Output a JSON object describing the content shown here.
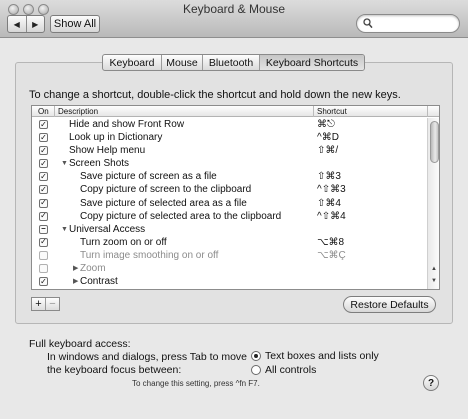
{
  "window": {
    "title": "Keyboard & Mouse",
    "show_all_label": "Show All",
    "back_icon": "◀",
    "forward_icon": "▶",
    "search_value": "",
    "search_placeholder": ""
  },
  "tabs": [
    {
      "label": "Keyboard",
      "active": false
    },
    {
      "label": "Mouse",
      "active": false
    },
    {
      "label": "Bluetooth",
      "active": false
    },
    {
      "label": "Keyboard Shortcuts",
      "active": true
    }
  ],
  "instructions": "To change a shortcut, double-click the shortcut and hold down the new keys.",
  "table": {
    "col_on": "On",
    "col_description": "Description",
    "col_shortcut": "Shortcut",
    "rows": [
      {
        "state": "checked",
        "indent": 1,
        "expander": "",
        "description": "Hide and show Front Row",
        "shortcut": "⌘⎋",
        "dim": false
      },
      {
        "state": "checked",
        "indent": 1,
        "expander": "",
        "description": "Look up in Dictionary",
        "shortcut": "^⌘D",
        "dim": false
      },
      {
        "state": "checked",
        "indent": 1,
        "expander": "",
        "description": "Show Help menu",
        "shortcut": "⇧⌘/",
        "dim": false
      },
      {
        "state": "checked",
        "indent": 0,
        "expander": "▼",
        "description": "Screen Shots",
        "shortcut": "",
        "dim": false
      },
      {
        "state": "checked",
        "indent": 2,
        "expander": "",
        "description": "Save picture of screen as a file",
        "shortcut": "⇧⌘3",
        "dim": false
      },
      {
        "state": "checked",
        "indent": 2,
        "expander": "",
        "description": "Copy picture of screen to the clipboard",
        "shortcut": "^⇧⌘3",
        "dim": false
      },
      {
        "state": "checked",
        "indent": 2,
        "expander": "",
        "description": "Save picture of selected area as a file",
        "shortcut": "⇧⌘4",
        "dim": false
      },
      {
        "state": "checked",
        "indent": 2,
        "expander": "",
        "description": "Copy picture of selected area to the clipboard",
        "shortcut": "^⇧⌘4",
        "dim": false
      },
      {
        "state": "mixed",
        "indent": 0,
        "expander": "▼",
        "description": "Universal Access",
        "shortcut": "",
        "dim": false
      },
      {
        "state": "checked",
        "indent": 2,
        "expander": "",
        "description": "Turn zoom on or off",
        "shortcut": "⌥⌘8",
        "dim": false
      },
      {
        "state": "unchecked",
        "indent": 2,
        "expander": "",
        "description": "Turn image smoothing on or off",
        "shortcut": "⌥⌘Ç",
        "dim": true
      },
      {
        "state": "unchecked",
        "indent": 1,
        "expander": "▶",
        "description": "Zoom",
        "shortcut": "",
        "dim": true
      },
      {
        "state": "checked",
        "indent": 1,
        "expander": "▶",
        "description": "Contrast",
        "shortcut": "",
        "dim": false
      }
    ]
  },
  "buttons": {
    "add": "+",
    "remove": "−",
    "restore_defaults": "Restore Defaults",
    "help": "?"
  },
  "full_keyboard": {
    "title": "Full keyboard access:",
    "desc_line1": "In windows and dialogs, press Tab to move",
    "desc_line2": "the keyboard focus between:",
    "option_text_boxes": "Text boxes and lists only",
    "option_all_controls": "All controls",
    "selected": "text_boxes",
    "note": "To change this setting, press ^fn F7."
  }
}
